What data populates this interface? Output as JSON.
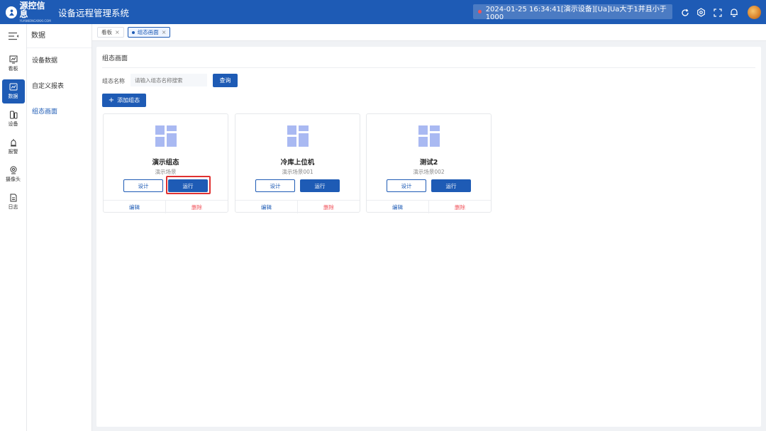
{
  "header": {
    "logo_cn": "源控信息",
    "logo_en": "YUANKONGXINXI.COM",
    "app_title": "设备远程管理系统",
    "alarm_text": "2024-01-25 16:34:41[演示设备][Ua]Ua大于1并且小于1000"
  },
  "rail": {
    "items": [
      {
        "label": "看板",
        "icon": "dashboard-icon"
      },
      {
        "label": "数据",
        "icon": "chart-icon"
      },
      {
        "label": "设备",
        "icon": "device-icon"
      },
      {
        "label": "报警",
        "icon": "alarm-icon"
      },
      {
        "label": "摄像头",
        "icon": "camera-icon"
      },
      {
        "label": "日志",
        "icon": "log-icon"
      }
    ]
  },
  "submenu": {
    "title": "数据",
    "items": [
      {
        "label": "设备数据"
      },
      {
        "label": "自定义报表"
      },
      {
        "label": "组态画面"
      }
    ]
  },
  "tabs": [
    {
      "label": "看板"
    },
    {
      "label": "组态画面"
    }
  ],
  "main": {
    "title": "组态画面",
    "search_label": "组态名称",
    "search_placeholder": "请输入组态名称搜索",
    "search_button": "查询",
    "add_button": "添加组态"
  },
  "cards": [
    {
      "name": "演示组态",
      "desc": "演示场景",
      "design": "设计",
      "run": "运行",
      "edit": "编辑",
      "delete": "删除"
    },
    {
      "name": "冷库上位机",
      "desc": "演示场景001",
      "design": "设计",
      "run": "运行",
      "edit": "编辑",
      "delete": "删除"
    },
    {
      "name": "测试2",
      "desc": "演示场景002",
      "design": "设计",
      "run": "运行",
      "edit": "编辑",
      "delete": "删除"
    }
  ],
  "colors": {
    "primary": "#1e5bb5",
    "danger": "#f0525a",
    "highlight": "#e03131"
  }
}
